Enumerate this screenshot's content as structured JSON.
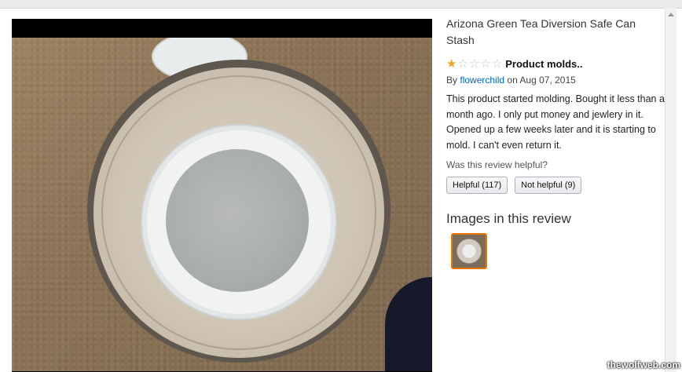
{
  "product": {
    "title": "Arizona Green Tea Diversion Safe Can Stash"
  },
  "review": {
    "rating": 1,
    "max_rating": 5,
    "title": "Product molds..",
    "by": "By",
    "author": "flowerchild",
    "on": "on Aug 07, 2015",
    "body": "This product started molding. Bought it less than a month ago. I only put money and jewlery in it. Opened up a few weeks later and it is starting to mold. I can't even return it."
  },
  "helpful": {
    "question": "Was this review helpful?",
    "helpful_label": "Helpful (117)",
    "not_helpful_label": "Not helpful (9)"
  },
  "images_section": {
    "heading": "Images in this review"
  },
  "colors": {
    "star": "#f0a526",
    "link": "#0066c0",
    "thumb_border": "#e77600"
  },
  "watermark": "thewolfweb.com"
}
